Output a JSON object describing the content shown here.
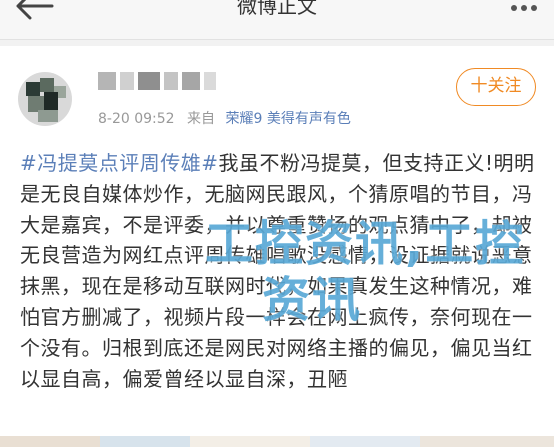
{
  "nav": {
    "title": "微博正文",
    "back_icon": "back-arrow-icon",
    "more_icon": "more-dots-icon"
  },
  "post": {
    "author_name": "",
    "timestamp": "8-20 09:52",
    "source_prefix": "来自",
    "device": "荣耀9 美得有声有色",
    "follow_label": "十关注",
    "topic": "#冯提莫点评周传雄#",
    "body": "我虽不粉冯提莫，但支持正义!明明是无良自媒体炒作，无脑网民跟风，个猜原唱的节目，冯大是嘉宾，不是评委，并以尊重赞扬的观点猜中了，却被无良营造为网红点评周传雄唱歌没感情，没证据就说恶意抹黑，现在是移动互联网时代，如果真发生这种情况，难怕官方删减了，视频片段一样会在网上疯传，奈何现在一个没有。归根到底还是网民对网络主播的偏见，偏见当红以显自高，偏爱曾经以显自深，丑陋"
  },
  "watermark": {
    "line1": "工控资讯,工控",
    "line2": "资讯",
    "color": "#5aa9d6"
  },
  "colors": {
    "accent": "#f08a24",
    "link": "#5b7fb8",
    "meta": "#999999"
  }
}
